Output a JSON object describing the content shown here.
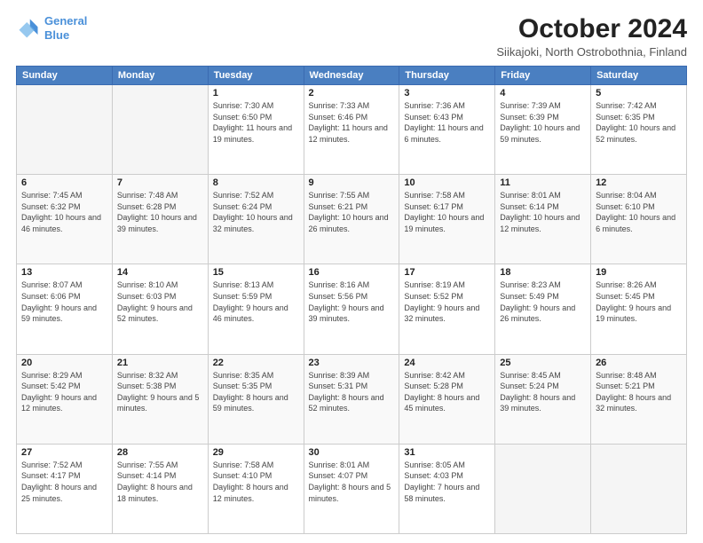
{
  "logo": {
    "line1": "General",
    "line2": "Blue"
  },
  "title": "October 2024",
  "subtitle": "Siikajoki, North Ostrobothnia, Finland",
  "days_header": [
    "Sunday",
    "Monday",
    "Tuesday",
    "Wednesday",
    "Thursday",
    "Friday",
    "Saturday"
  ],
  "weeks": [
    [
      {
        "day": "",
        "detail": ""
      },
      {
        "day": "",
        "detail": ""
      },
      {
        "day": "1",
        "detail": "Sunrise: 7:30 AM\nSunset: 6:50 PM\nDaylight: 11 hours\nand 19 minutes."
      },
      {
        "day": "2",
        "detail": "Sunrise: 7:33 AM\nSunset: 6:46 PM\nDaylight: 11 hours\nand 12 minutes."
      },
      {
        "day": "3",
        "detail": "Sunrise: 7:36 AM\nSunset: 6:43 PM\nDaylight: 11 hours\nand 6 minutes."
      },
      {
        "day": "4",
        "detail": "Sunrise: 7:39 AM\nSunset: 6:39 PM\nDaylight: 10 hours\nand 59 minutes."
      },
      {
        "day": "5",
        "detail": "Sunrise: 7:42 AM\nSunset: 6:35 PM\nDaylight: 10 hours\nand 52 minutes."
      }
    ],
    [
      {
        "day": "6",
        "detail": "Sunrise: 7:45 AM\nSunset: 6:32 PM\nDaylight: 10 hours\nand 46 minutes."
      },
      {
        "day": "7",
        "detail": "Sunrise: 7:48 AM\nSunset: 6:28 PM\nDaylight: 10 hours\nand 39 minutes."
      },
      {
        "day": "8",
        "detail": "Sunrise: 7:52 AM\nSunset: 6:24 PM\nDaylight: 10 hours\nand 32 minutes."
      },
      {
        "day": "9",
        "detail": "Sunrise: 7:55 AM\nSunset: 6:21 PM\nDaylight: 10 hours\nand 26 minutes."
      },
      {
        "day": "10",
        "detail": "Sunrise: 7:58 AM\nSunset: 6:17 PM\nDaylight: 10 hours\nand 19 minutes."
      },
      {
        "day": "11",
        "detail": "Sunrise: 8:01 AM\nSunset: 6:14 PM\nDaylight: 10 hours\nand 12 minutes."
      },
      {
        "day": "12",
        "detail": "Sunrise: 8:04 AM\nSunset: 6:10 PM\nDaylight: 10 hours\nand 6 minutes."
      }
    ],
    [
      {
        "day": "13",
        "detail": "Sunrise: 8:07 AM\nSunset: 6:06 PM\nDaylight: 9 hours\nand 59 minutes."
      },
      {
        "day": "14",
        "detail": "Sunrise: 8:10 AM\nSunset: 6:03 PM\nDaylight: 9 hours\nand 52 minutes."
      },
      {
        "day": "15",
        "detail": "Sunrise: 8:13 AM\nSunset: 5:59 PM\nDaylight: 9 hours\nand 46 minutes."
      },
      {
        "day": "16",
        "detail": "Sunrise: 8:16 AM\nSunset: 5:56 PM\nDaylight: 9 hours\nand 39 minutes."
      },
      {
        "day": "17",
        "detail": "Sunrise: 8:19 AM\nSunset: 5:52 PM\nDaylight: 9 hours\nand 32 minutes."
      },
      {
        "day": "18",
        "detail": "Sunrise: 8:23 AM\nSunset: 5:49 PM\nDaylight: 9 hours\nand 26 minutes."
      },
      {
        "day": "19",
        "detail": "Sunrise: 8:26 AM\nSunset: 5:45 PM\nDaylight: 9 hours\nand 19 minutes."
      }
    ],
    [
      {
        "day": "20",
        "detail": "Sunrise: 8:29 AM\nSunset: 5:42 PM\nDaylight: 9 hours\nand 12 minutes."
      },
      {
        "day": "21",
        "detail": "Sunrise: 8:32 AM\nSunset: 5:38 PM\nDaylight: 9 hours\nand 5 minutes."
      },
      {
        "day": "22",
        "detail": "Sunrise: 8:35 AM\nSunset: 5:35 PM\nDaylight: 8 hours\nand 59 minutes."
      },
      {
        "day": "23",
        "detail": "Sunrise: 8:39 AM\nSunset: 5:31 PM\nDaylight: 8 hours\nand 52 minutes."
      },
      {
        "day": "24",
        "detail": "Sunrise: 8:42 AM\nSunset: 5:28 PM\nDaylight: 8 hours\nand 45 minutes."
      },
      {
        "day": "25",
        "detail": "Sunrise: 8:45 AM\nSunset: 5:24 PM\nDaylight: 8 hours\nand 39 minutes."
      },
      {
        "day": "26",
        "detail": "Sunrise: 8:48 AM\nSunset: 5:21 PM\nDaylight: 8 hours\nand 32 minutes."
      }
    ],
    [
      {
        "day": "27",
        "detail": "Sunrise: 7:52 AM\nSunset: 4:17 PM\nDaylight: 8 hours\nand 25 minutes."
      },
      {
        "day": "28",
        "detail": "Sunrise: 7:55 AM\nSunset: 4:14 PM\nDaylight: 8 hours\nand 18 minutes."
      },
      {
        "day": "29",
        "detail": "Sunrise: 7:58 AM\nSunset: 4:10 PM\nDaylight: 8 hours\nand 12 minutes."
      },
      {
        "day": "30",
        "detail": "Sunrise: 8:01 AM\nSunset: 4:07 PM\nDaylight: 8 hours\nand 5 minutes."
      },
      {
        "day": "31",
        "detail": "Sunrise: 8:05 AM\nSunset: 4:03 PM\nDaylight: 7 hours\nand 58 minutes."
      },
      {
        "day": "",
        "detail": ""
      },
      {
        "day": "",
        "detail": ""
      }
    ]
  ]
}
